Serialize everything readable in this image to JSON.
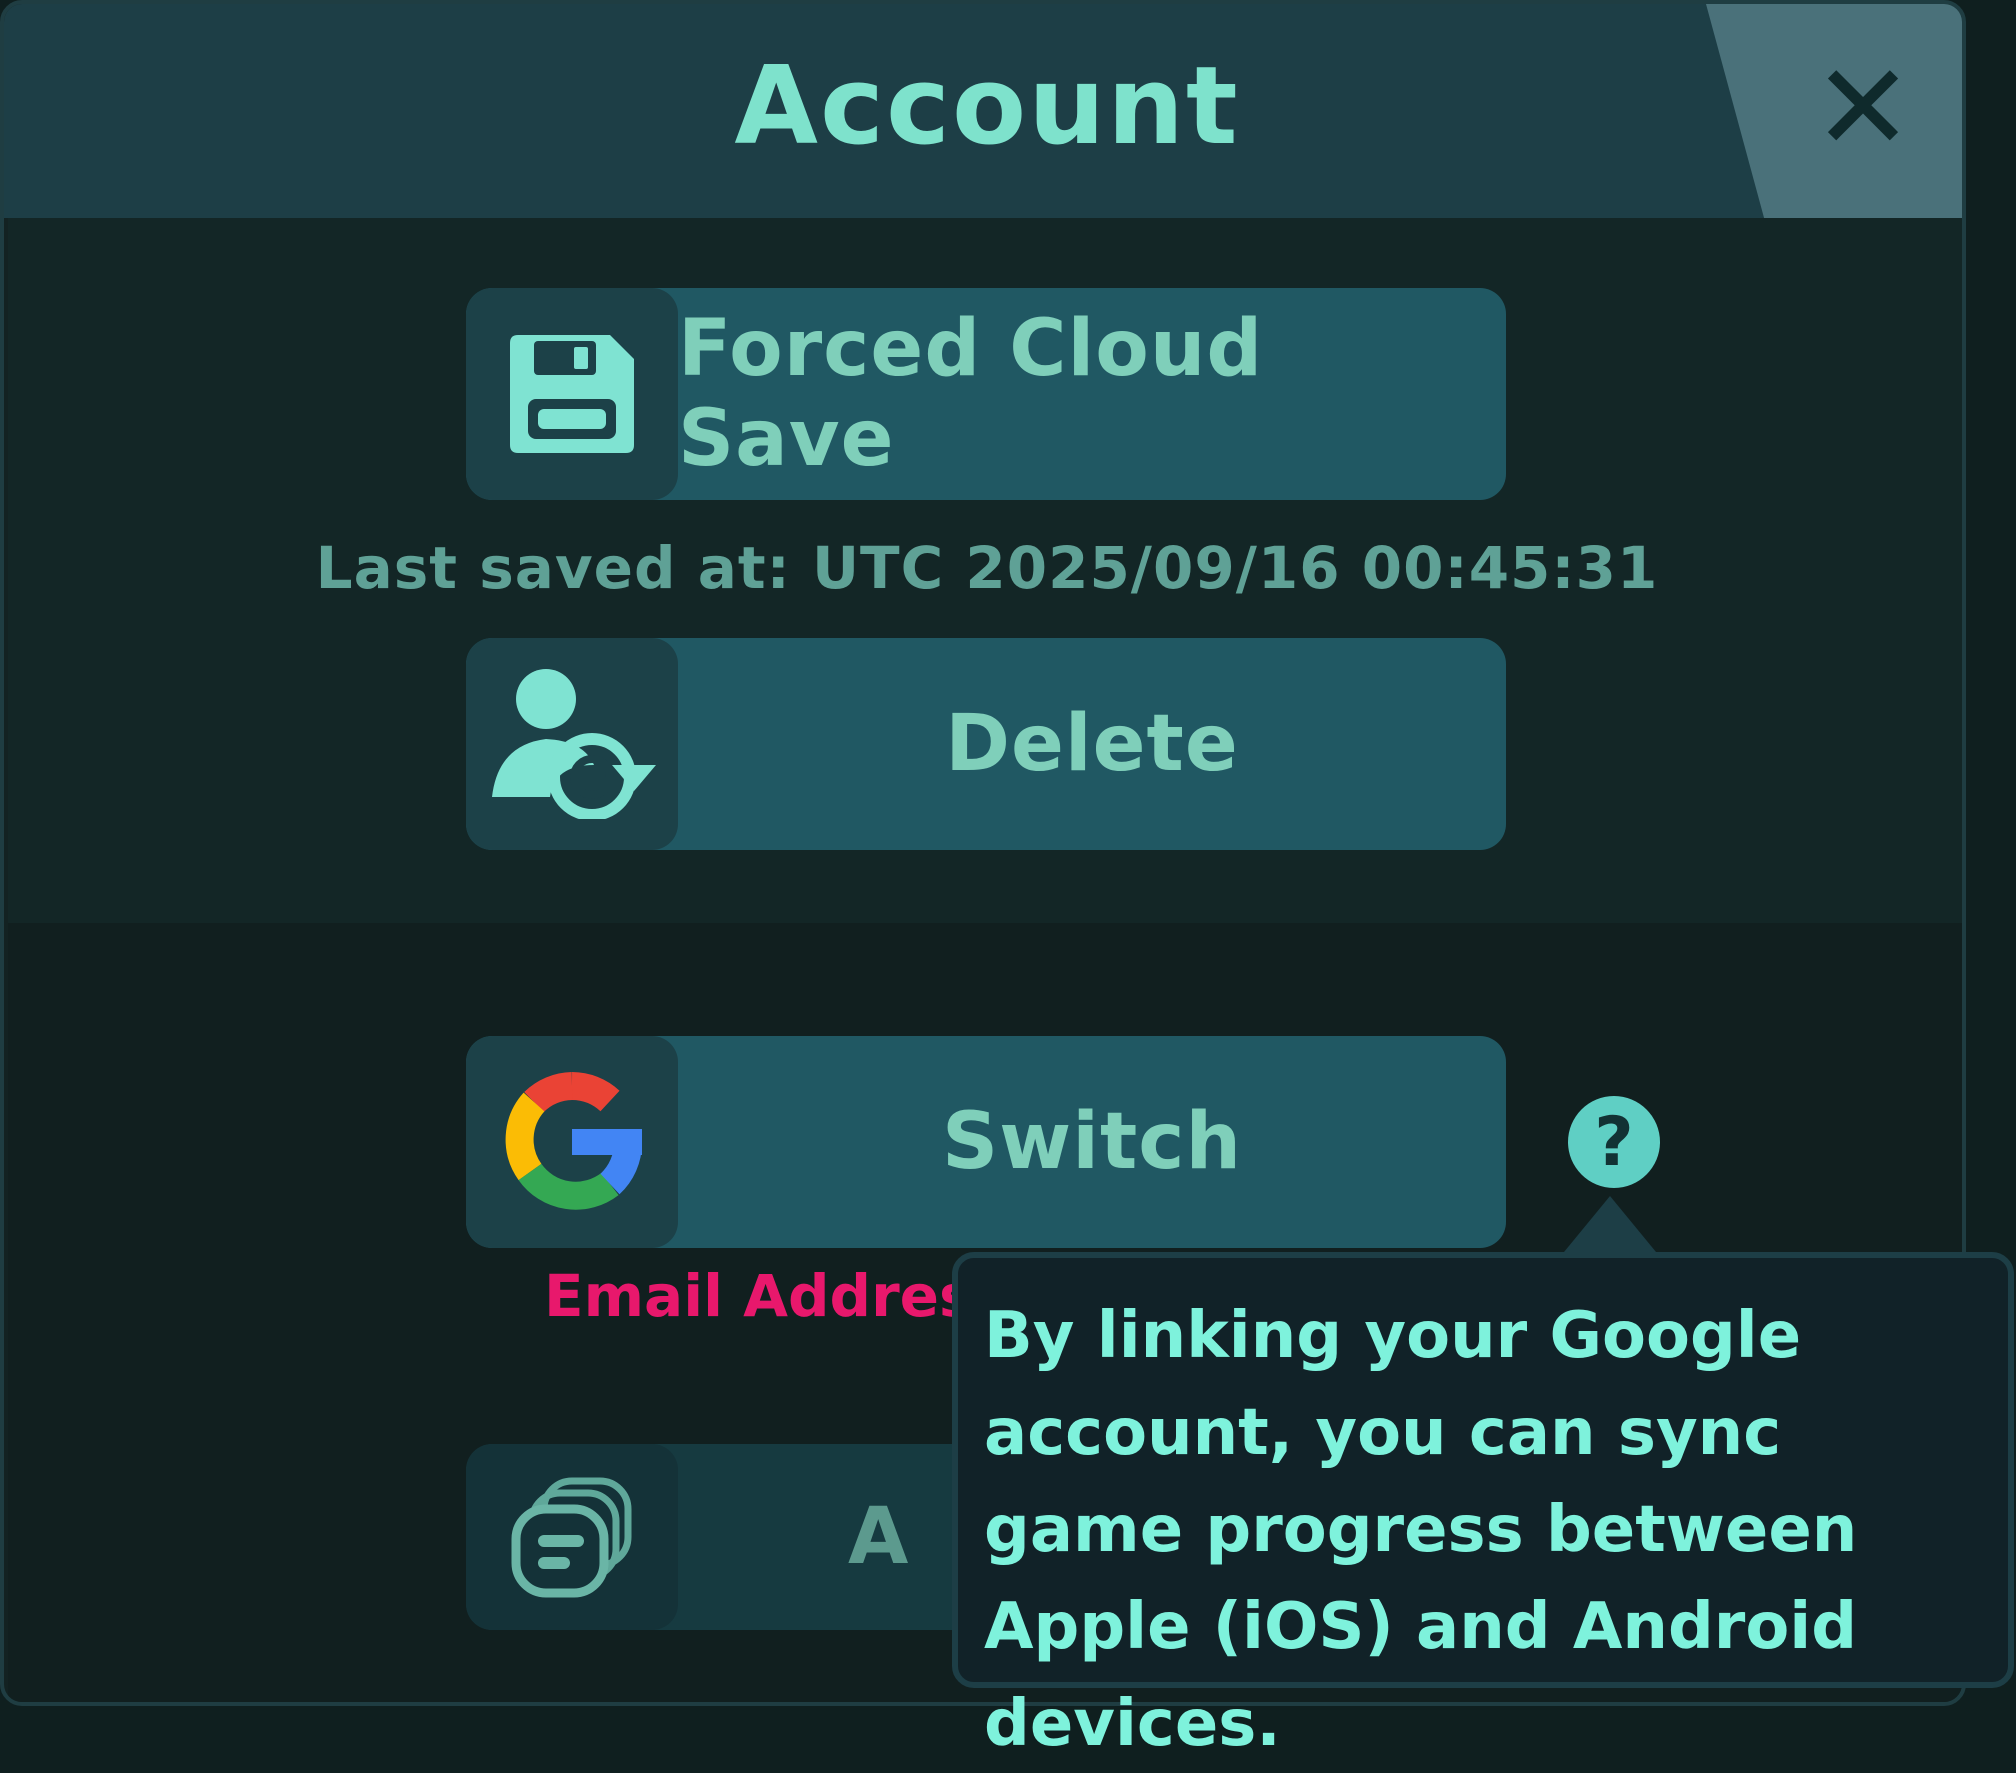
{
  "header": {
    "title": "Account",
    "close_label": "✕"
  },
  "buttons": {
    "cloud_save": {
      "label": "Forced Cloud Save",
      "icon": "floppy-disk-icon"
    },
    "delete": {
      "label": "Delete",
      "icon": "user-reset-icon"
    },
    "switch": {
      "label": "Switch",
      "icon": "google-icon"
    },
    "fourth": {
      "label": "A",
      "icon": "stacked-cards-icon"
    }
  },
  "last_saved": "Last saved at: UTC 2025/09/16 00:45:31",
  "email_label": "Email Address",
  "help": {
    "label": "?"
  },
  "tooltip": {
    "text": "By linking your Google account, you can sync game progress between Apple (iOS) and Android devices."
  },
  "colors": {
    "accent": "#7ee2cc",
    "button": "#205863",
    "email": "#e8186c"
  }
}
